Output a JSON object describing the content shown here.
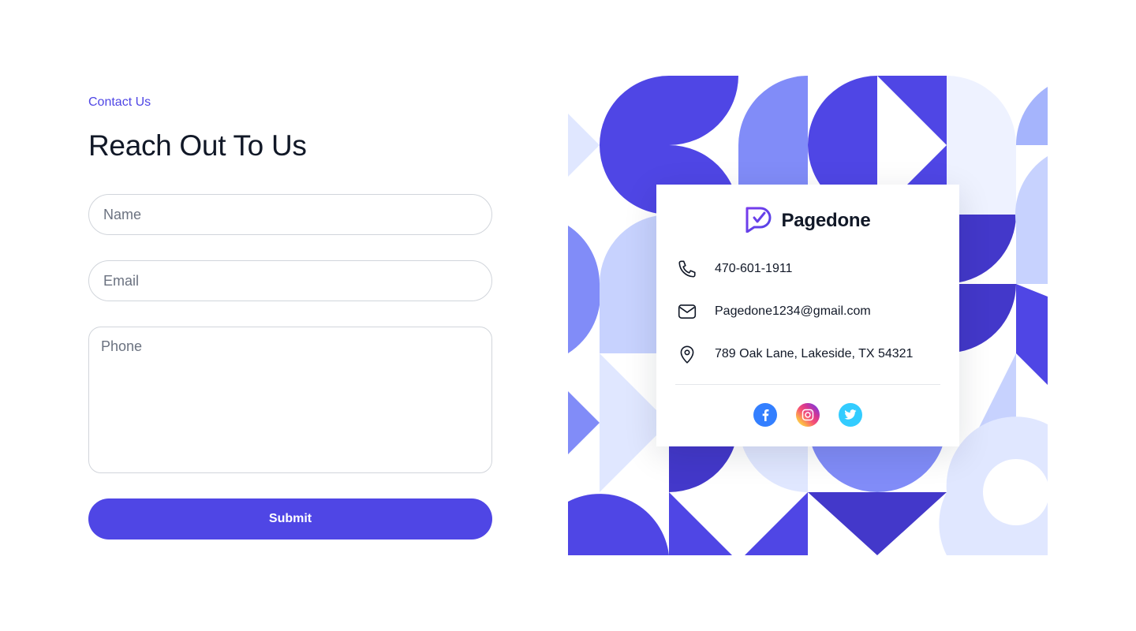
{
  "form": {
    "eyebrow": "Contact Us",
    "title": "Reach Out To Us",
    "name_placeholder": "Name",
    "email_placeholder": "Email",
    "phone_placeholder": "Phone",
    "submit_label": "Submit"
  },
  "card": {
    "brand": "Pagedone",
    "phone": "470-601-1911",
    "email": "Pagedone1234@gmail.com",
    "address": "789 Oak Lane, Lakeside, TX 54321",
    "socials": [
      "facebook-icon",
      "instagram-icon",
      "twitter-icon"
    ]
  },
  "colors": {
    "accent": "#4F46E5",
    "pattern_dark": "#4338CA",
    "pattern_mid": "#818CF8",
    "pattern_light": "#C7D2FE",
    "pattern_pale": "#E0E7FF",
    "facebook": "#337FFF",
    "twitter": "#33CCFF"
  }
}
